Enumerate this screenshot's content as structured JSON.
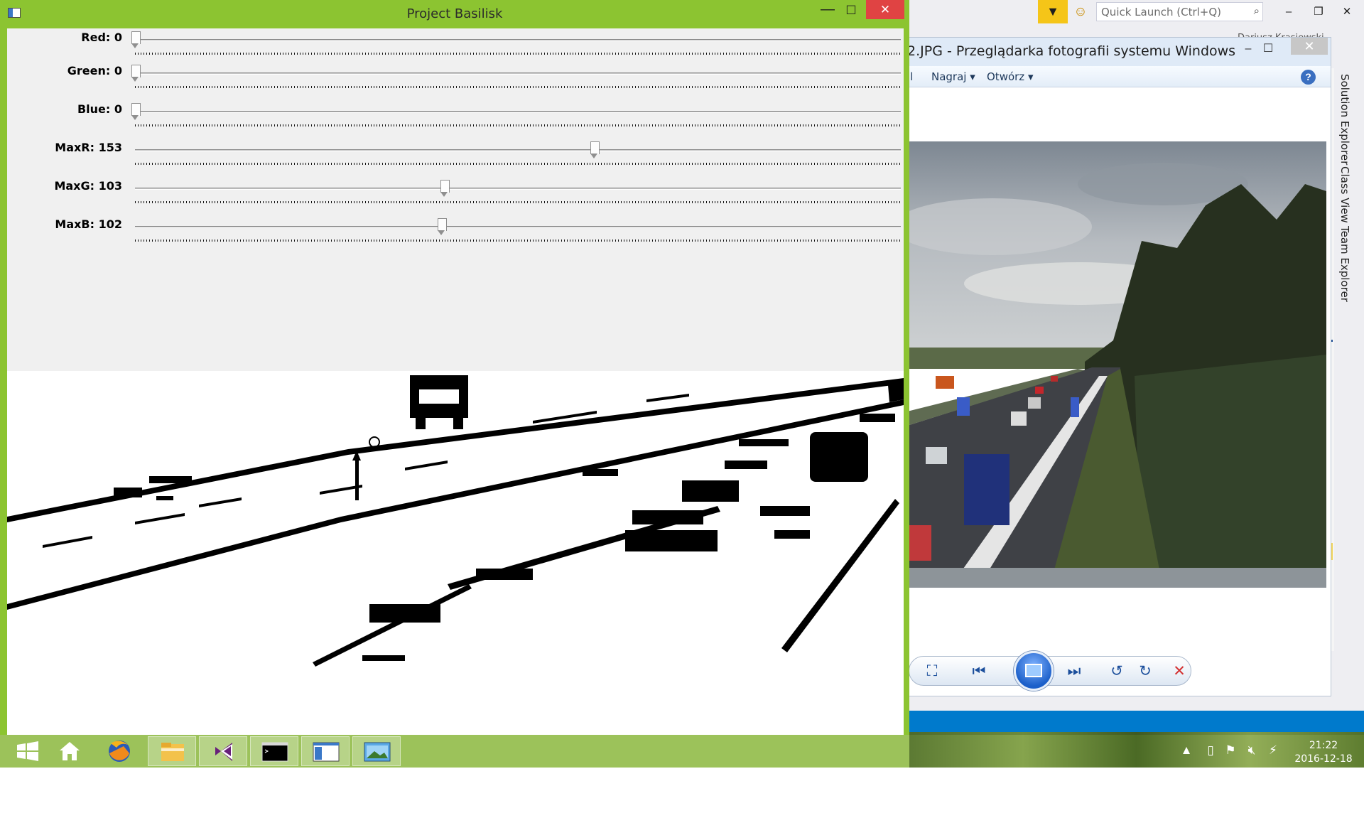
{
  "app": {
    "title": "Project Basilisk",
    "controls": {
      "minimize": "—",
      "maximize": "☐",
      "close": "✕"
    },
    "trackbars": [
      {
        "label": "Red: 0",
        "value": 0,
        "max": 255
      },
      {
        "label": "Green: 0",
        "value": 0,
        "max": 255
      },
      {
        "label": "Blue: 0",
        "value": 0,
        "max": 255
      },
      {
        "label": "MaxR: 153",
        "value": 153,
        "max": 255
      },
      {
        "label": "MaxG: 103",
        "value": 103,
        "max": 255
      },
      {
        "label": "MaxB: 102",
        "value": 102,
        "max": 255
      }
    ]
  },
  "vs": {
    "quick_launch_placeholder": "Quick Launch (Ctrl+Q)",
    "user": "Dariusz Krasiewski",
    "side_tabs": [
      "Solution Explorer",
      "Class View",
      "Team Explorer"
    ]
  },
  "photo_viewer": {
    "title": "2.JPG - Przeglądarka fotografii systemu Windows",
    "menu": [
      {
        "label": "il"
      },
      {
        "label": "Nagraj",
        "arrow": "▾"
      },
      {
        "label": "Otwórz",
        "arrow": "▾"
      }
    ],
    "help": "?"
  },
  "taskbar": {
    "clock_time": "21:22",
    "clock_date": "2016-12-18",
    "items": [
      "start-icon",
      "home-icon",
      "firefox-icon",
      "file-explorer-icon",
      "visual-studio-icon",
      "console-icon",
      "app-window-icon",
      "photo-viewer-icon"
    ]
  },
  "colors": {
    "window_accent": "#8cc431",
    "close_red": "#e04343",
    "vs_blue": "#007acc",
    "taskbar": "#9cc25a"
  }
}
